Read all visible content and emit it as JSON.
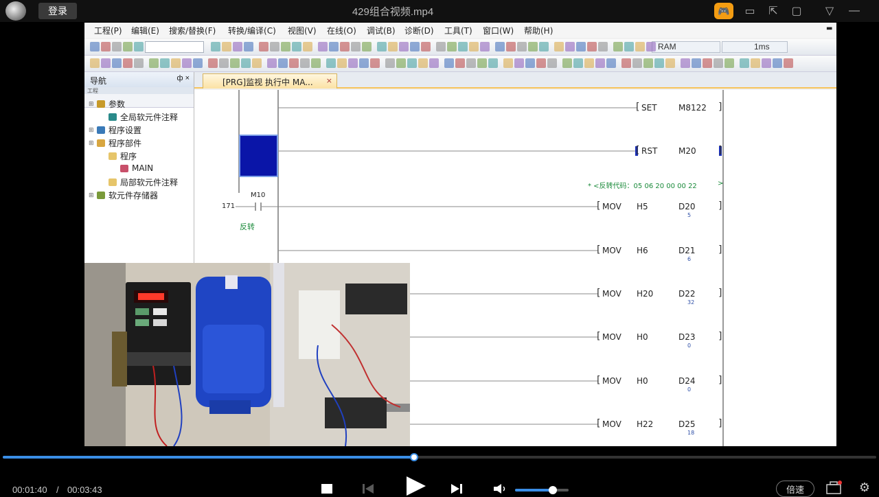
{
  "player": {
    "login_label": "登录",
    "video_title": "429组合视频.mp4",
    "current_time": "00:01:40",
    "time_separator": "/",
    "total_time": "00:03:43",
    "progress": 0.4709,
    "volume": 0.7,
    "speed_label": "倍速",
    "accent_color": "#3a8ee6"
  },
  "app": {
    "menu": [
      "工程(P)",
      "编辑(E)",
      "搜索/替换(F)",
      "转换/编译(C)",
      "视图(V)",
      "在线(O)",
      "调试(B)",
      "诊断(D)",
      "工具(T)",
      "窗口(W)",
      "帮助(H)"
    ],
    "ram_label": "RAM",
    "scan_label": "1ms",
    "nav_title": "导航",
    "nav_pin": "ф ×",
    "nav_sub": "工程",
    "tree": [
      {
        "label": "参数",
        "indent": 0
      },
      {
        "label": "全局软元件注释",
        "indent": 1
      },
      {
        "label": "程序设置",
        "indent": 0
      },
      {
        "label": "程序部件",
        "indent": 0
      },
      {
        "label": "程序",
        "indent": 1
      },
      {
        "label": "MAIN",
        "indent": 2
      },
      {
        "label": "局部软元件注释",
        "indent": 1
      },
      {
        "label": "软元件存储器",
        "indent": 0
      }
    ],
    "tab_label": "[PRG]监视 执行中 MA...",
    "tab_close": "×"
  },
  "ladder": {
    "step_number": "171",
    "contact_label": "M10",
    "contact_comment": "反转",
    "comment_line": "* <反转代码：05 06 20 00 00 22",
    "comment_end": ">",
    "coils": [
      {
        "instr": "SET",
        "op1": "",
        "op2": "M8122",
        "value": ""
      },
      {
        "instr": "RST",
        "op1": "",
        "op2": "M20",
        "value": ""
      },
      {
        "instr": "MOV",
        "op1": "H5",
        "op2": "D20",
        "value": "5"
      },
      {
        "instr": "MOV",
        "op1": "H6",
        "op2": "D21",
        "value": "6"
      },
      {
        "instr": "MOV",
        "op1": "H20",
        "op2": "D22",
        "value": "32"
      },
      {
        "instr": "MOV",
        "op1": "H0",
        "op2": "D23",
        "value": "0"
      },
      {
        "instr": "MOV",
        "op1": "H0",
        "op2": "D24",
        "value": "0"
      },
      {
        "instr": "MOV",
        "op1": "H22",
        "op2": "D25",
        "value": "18"
      }
    ]
  }
}
